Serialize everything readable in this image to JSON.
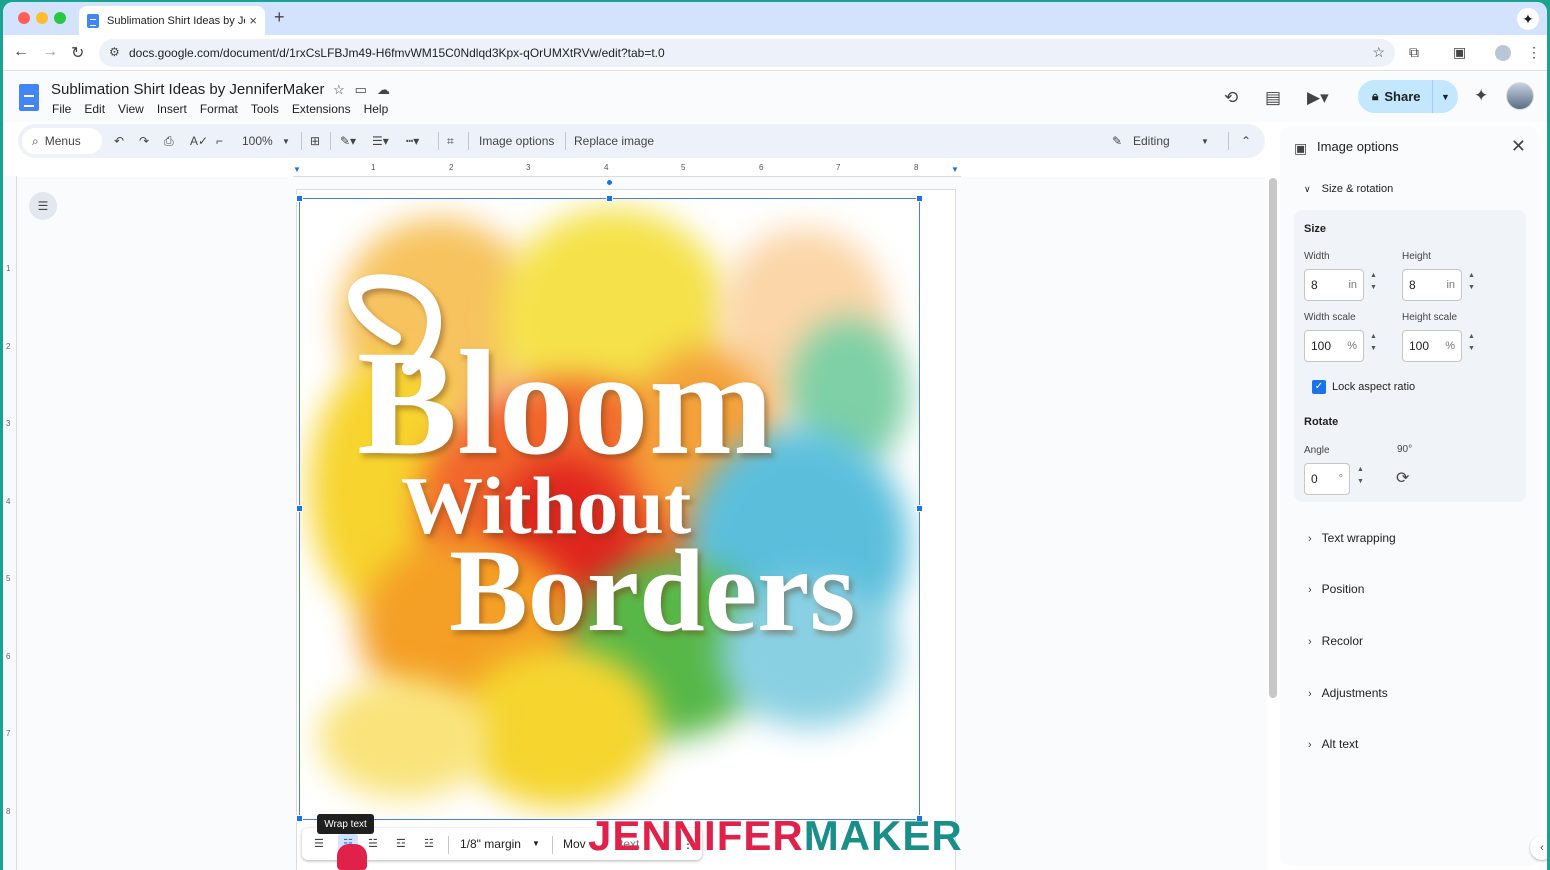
{
  "browser": {
    "tab_title": "Sublimation Shirt Ideas by Je",
    "tab_close": "×",
    "new_tab": "+",
    "url": "docs.google.com/document/d/1rxCsLFBJm49-H6fmvWM15C0Ndlqd3Kpx-qOrUMXtRVw/edit?tab=t.0"
  },
  "doc": {
    "title": "Sublimation Shirt Ideas by JenniferMaker",
    "menus": [
      "File",
      "Edit",
      "View",
      "Insert",
      "Format",
      "Tools",
      "Extensions",
      "Help"
    ],
    "share_label": "Share"
  },
  "toolbar": {
    "menus_label": "Menus",
    "zoom": "100%",
    "image_options": "Image options",
    "replace_image": "Replace image",
    "mode": "Editing"
  },
  "ruler": {
    "h_ticks": [
      "1",
      "2",
      "3",
      "4",
      "5",
      "6",
      "7",
      "8"
    ],
    "v_ticks": [
      "1",
      "2",
      "3",
      "4",
      "5",
      "6",
      "7",
      "8"
    ]
  },
  "image": {
    "line1": "Bloom",
    "line2": "Without",
    "line3": "Borders"
  },
  "image_bar": {
    "tooltip": "Wrap text",
    "margin": "1/8\" margin",
    "move": "Mov",
    "move_tail": "text"
  },
  "watermark": {
    "part1": "JENNIFER",
    "part2": "MAKER"
  },
  "panel": {
    "title": "Image options",
    "size_rotation": "Size & rotation",
    "size": "Size",
    "width_label": "Width",
    "height_label": "Height",
    "width_value": "8",
    "height_value": "8",
    "unit_in": "in",
    "width_scale_label": "Width scale",
    "height_scale_label": "Height scale",
    "width_scale_value": "100",
    "height_scale_value": "100",
    "unit_pct": "%",
    "lock_aspect": "Lock aspect ratio",
    "rotate": "Rotate",
    "angle_label": "Angle",
    "angle_value": "0",
    "unit_deg": "°",
    "rot90_label": "90°",
    "sections": [
      "Text wrapping",
      "Position",
      "Recolor",
      "Adjustments",
      "Alt text"
    ]
  },
  "colors": {
    "accent": "#1a73e8",
    "share_bg": "#c2e7ff",
    "watermark_red": "#e0224b",
    "watermark_teal": "#1a8f8a"
  }
}
